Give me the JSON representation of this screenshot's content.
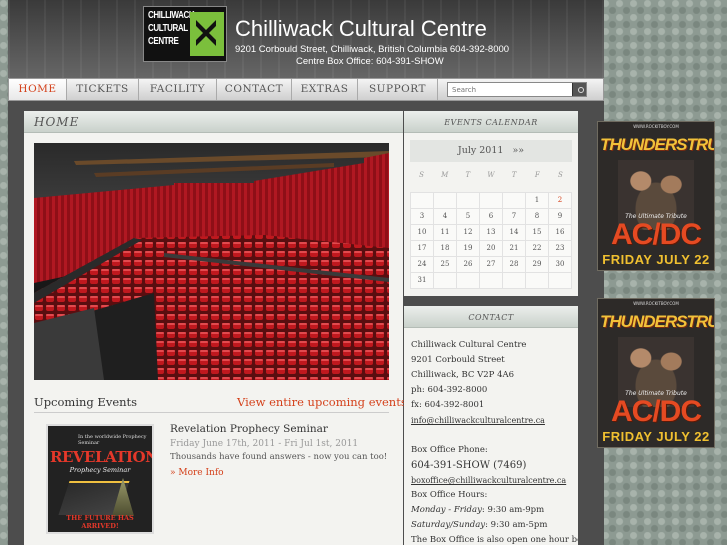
{
  "header": {
    "logo_text": "CHILLIWACK\nCULTURAL\nCENTRE",
    "title": "Chilliwack Cultural Centre",
    "address": "9201 Corbould Street, Chilliwack, British Columbia   604-392-8000",
    "box_office": "Centre Box Office: 604-391-SHOW"
  },
  "nav": {
    "items": [
      {
        "label": "HOME",
        "active": true
      },
      {
        "label": "TICKETS"
      },
      {
        "label": "FACILITY"
      },
      {
        "label": "CONTACT"
      },
      {
        "label": "EXTRAS"
      },
      {
        "label": "SUPPORT"
      }
    ],
    "search_placeholder": "Search"
  },
  "main": {
    "title": "HOME",
    "upcoming_heading": "Upcoming Events",
    "upcoming_link": "View entire upcoming events list »",
    "event": {
      "poster_top": "In the worldwide Prophecy Seminar",
      "poster_title": "REVELATION",
      "poster_sub": "Prophecy Seminar",
      "poster_foot": "THE FUTURE HAS ARRIVED!",
      "title": "Revelation Prophecy Seminar",
      "date": "Friday June 17th, 2011 - Fri Jul 1st, 2011",
      "description": "Thousands have found answers - now you can too!",
      "more": "» More Info"
    }
  },
  "calendar": {
    "title": "EVENTS CALENDAR",
    "month": "July 2011",
    "next": "»»",
    "dow": [
      "S",
      "M",
      "T",
      "W",
      "T",
      "F",
      "S"
    ],
    "rows": [
      [
        "",
        "",
        "",
        "",
        "",
        "1",
        "2"
      ],
      [
        "3",
        "4",
        "5",
        "6",
        "7",
        "8",
        "9"
      ],
      [
        "10",
        "11",
        "12",
        "13",
        "14",
        "15",
        "16"
      ],
      [
        "17",
        "18",
        "19",
        "20",
        "21",
        "22",
        "23"
      ],
      [
        "24",
        "25",
        "26",
        "27",
        "28",
        "29",
        "30"
      ],
      [
        "31",
        "",
        "",
        "",
        "",
        "",
        ""
      ]
    ],
    "highlight": "2"
  },
  "contact": {
    "title": "CONTACT",
    "name": "Chilliwack Cultural Centre",
    "street": "9201 Corbould Street",
    "city": "Chilliwack, BC V2P 4A6",
    "phone": "ph: 604-392-8000",
    "fax": "fx: 604-392-8001",
    "email": "info@chilliwackculturalcentre.ca",
    "box_office_label": "Box Office Phone:",
    "box_office_phone": "604-391-SHOW (7469)",
    "box_office_email": "boxoffice@chilliwackculturalcentre.ca",
    "hours_label": "Box Office Hours:",
    "hours_weekday_day": "Monday - Friday",
    "hours_weekday": ": 9:30 am-9pm",
    "hours_weekend_day": "Saturday/Sunday",
    "hours_weekend": ": 9:30 am-5pm",
    "note": "The Box Office is also open one hour before all"
  },
  "ads": [
    {
      "site": "WWW.ROCKITBOY.COM",
      "title": "THUNDERSTRUCK",
      "tribute": "The Ultimate Tribute",
      "band": "AC/DC",
      "date": "FRIDAY JULY 22"
    },
    {
      "site": "WWW.ROCKITBOY.COM",
      "title": "THUNDERSTRUCK",
      "tribute": "The Ultimate Tribute",
      "band": "AC/DC",
      "date": "FRIDAY JULY 22"
    }
  ]
}
